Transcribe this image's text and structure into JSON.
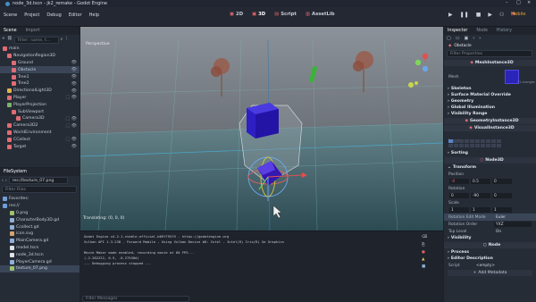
{
  "window": {
    "title": "node_3d.tscn - jk2_remake - Godot Engine",
    "controls": [
      "–",
      "□",
      "×"
    ]
  },
  "menu": [
    "Scene",
    "Project",
    "Debug",
    "Editor",
    "Help"
  ],
  "workspaces": [
    {
      "label": "2D",
      "icon": "2d-icon"
    },
    {
      "label": "3D",
      "icon": "3d-icon"
    },
    {
      "label": "Script",
      "icon": "script-icon"
    },
    {
      "label": "AssetLib",
      "icon": "assetlib-icon"
    }
  ],
  "play_buttons": [
    "▶",
    "❚❚",
    "■",
    "▶",
    "⚇",
    "⚑"
  ],
  "renderer": "Mobile",
  "scene_dock": {
    "tabs": [
      "Scene",
      "Import"
    ],
    "filter_placeholder": "Filter: name, t...",
    "nodes": [
      {
        "name": "main",
        "indent": 0,
        "color": "#e06c75",
        "icons": ""
      },
      {
        "name": "NavigationRegion3D",
        "indent": 1,
        "color": "#e06c75",
        "icons": ""
      },
      {
        "name": "Ground",
        "indent": 2,
        "color": "#e06c75",
        "icons": "👁"
      },
      {
        "name": "Obstacle",
        "indent": 2,
        "color": "#e06c75",
        "icons": "👁",
        "selected": true
      },
      {
        "name": "Tree1",
        "indent": 2,
        "color": "#e06c75",
        "icons": "👁"
      },
      {
        "name": "Tree2",
        "indent": 2,
        "color": "#e06c75",
        "icons": "👁"
      },
      {
        "name": "DirectionalLight3D",
        "indent": 1,
        "color": "#e0b24a",
        "icons": "👁"
      },
      {
        "name": "Player",
        "indent": 1,
        "color": "#e06c75",
        "icons": "⬚ 👁"
      },
      {
        "name": "PlayerProjection",
        "indent": 1,
        "color": "#7ab36b",
        "icons": ""
      },
      {
        "name": "SubViewport",
        "indent": 2,
        "color": "#e06c75",
        "icons": ""
      },
      {
        "name": "Camera3D",
        "indent": 3,
        "color": "#e06c75",
        "icons": "⬚ 👁"
      },
      {
        "name": "Camera3D2",
        "indent": 1,
        "color": "#e06c75",
        "icons": "⬚ 👁"
      },
      {
        "name": "WorldEnvironment",
        "indent": 1,
        "color": "#e06c75",
        "icons": ""
      },
      {
        "name": "CCollect",
        "indent": 1,
        "color": "#e06c75",
        "icons": "⬚ 👁"
      },
      {
        "name": "Target",
        "indent": 1,
        "color": "#e06c75",
        "icons": "👁"
      }
    ]
  },
  "filesystem": {
    "title": "FileSystem",
    "path": "res://texture_07.png",
    "filter_placeholder": "Filter Files",
    "items": [
      {
        "name": "Favorites:",
        "kind": "folder"
      },
      {
        "name": "res://",
        "kind": "folder"
      },
      {
        "name": "0.png",
        "kind": "png"
      },
      {
        "name": "CharacterBody3D.gd",
        "kind": "gd"
      },
      {
        "name": "Ccollect.gd",
        "kind": "gd"
      },
      {
        "name": "icon.svg",
        "kind": "svg"
      },
      {
        "name": "MainCamera.gd",
        "kind": "gd"
      },
      {
        "name": "model.tscn",
        "kind": "tscn"
      },
      {
        "name": "node_3d.tscn",
        "kind": "tscn"
      },
      {
        "name": "PlayerCamera.gd",
        "kind": "gd"
      },
      {
        "name": "texture_07.png",
        "kind": "png",
        "selected": true
      }
    ]
  },
  "editor_tabs": {
    "active": "node_3d",
    "close": "×",
    "add": "+"
  },
  "viewport": {
    "toolbar": [
      "Transform",
      "View",
      "Mesh"
    ],
    "label": "Perspective",
    "status": "Translating: (0, 0, 0)"
  },
  "output": {
    "lines": [
      "Godot Engine v4.2.1.stable.official.b09f793f5 - https://godotengine.org",
      "Vulkan API 1.3.238 - Forward Mobile - Using Vulkan Device #0: Intel - Intel(R) Iris(R) Xe Graphics",
      "",
      "Movie Maker mode enabled, recording movie at 60 FPS...",
      "(-2.282222, 0.5, -0.27558d)",
      "--- Debugging process stopped ---"
    ],
    "filter_placeholder": "Filter Messages"
  },
  "inspector": {
    "tabs": [
      "Inspector",
      "Node",
      "History"
    ],
    "node_name": "Obstacle",
    "filter_placeholder": "Filter Properties",
    "mesh_class": "MeshInstance3D",
    "mesh_label": "Mesh",
    "mesh_count": "71 changes",
    "groups_a": [
      "Skeleton",
      "Surface Material Override",
      "Geometry",
      "Global Illumination",
      "Visibility Range"
    ],
    "geometry_instance": "GeometryInstance3D",
    "visual_instance": "VisualInstance3D",
    "layers_label": "Layers",
    "sorting": "Sorting",
    "node3d": "Node3D",
    "transform": "Transform",
    "position": {
      "label": "Position",
      "x": "-0",
      "y": "0.5",
      "z": "0"
    },
    "rotation": {
      "label": "Rotation",
      "x": "0",
      "y": "-90",
      "z": "0"
    },
    "scale": {
      "label": "Scale",
      "x": "1",
      "y": "1",
      "z": "1"
    },
    "rotation_edit_mode": {
      "label": "Rotation Edit Mode",
      "value": "Euler"
    },
    "rotation_order": {
      "label": "Rotation Order",
      "value": "YXZ"
    },
    "top_level": {
      "label": "Top Level",
      "value": "On"
    },
    "visibility": "Visibility",
    "node": "Node",
    "process": "Process",
    "editor_description": "Editor Description",
    "script": {
      "label": "Script",
      "value": "<empty>"
    },
    "add_metadata": "Add Metadata"
  }
}
